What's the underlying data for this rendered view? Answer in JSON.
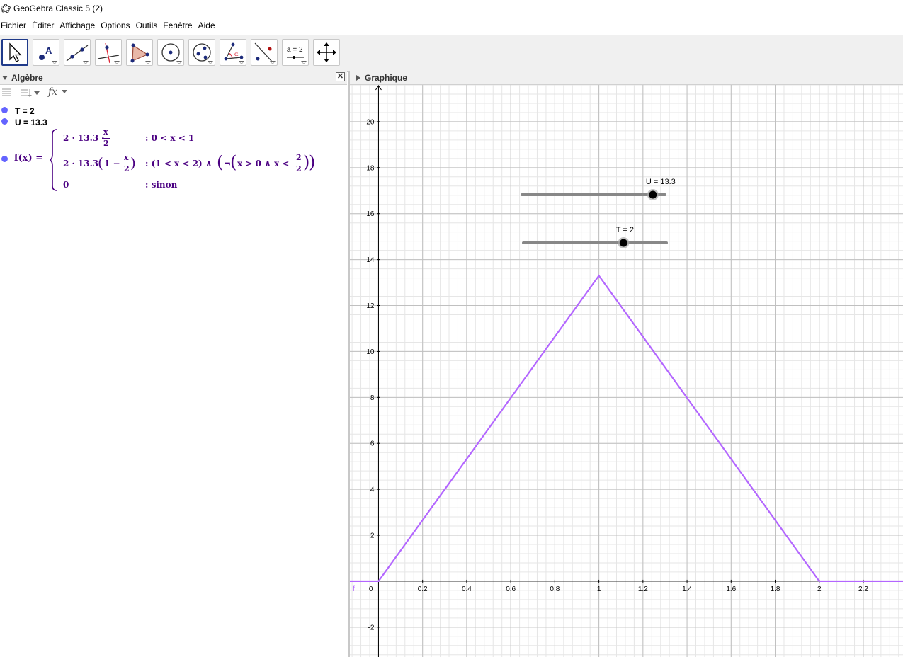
{
  "window": {
    "title": "GeoGebra Classic 5 (2)"
  },
  "menu": [
    "Fichier",
    "Éditer",
    "Affichage",
    "Options",
    "Outils",
    "Fenêtre",
    "Aide"
  ],
  "toolbar": {
    "tools": [
      {
        "name": "move-tool",
        "icon": "arrow-cursor-icon",
        "active": true
      },
      {
        "name": "point-tool",
        "icon": "point-icon"
      },
      {
        "name": "line-tool",
        "icon": "line-icon"
      },
      {
        "name": "perpendicular-tool",
        "icon": "perpendicular-icon"
      },
      {
        "name": "polygon-tool",
        "icon": "polygon-icon"
      },
      {
        "name": "circle-tool",
        "icon": "circle-icon"
      },
      {
        "name": "conic-tool",
        "icon": "ellipse-icon"
      },
      {
        "name": "angle-tool",
        "icon": "angle-icon"
      },
      {
        "name": "reflect-tool",
        "icon": "reflect-icon"
      },
      {
        "name": "slider-tool",
        "icon": "slider-icon",
        "label": "a = 2"
      },
      {
        "name": "move-graphics-tool",
        "icon": "move-arrows-icon"
      }
    ]
  },
  "algebra": {
    "title": "Algèbre",
    "items": [
      {
        "text": "T = 2"
      },
      {
        "text": "U = 13.3"
      }
    ],
    "function": {
      "name": "f(x) =",
      "case1_expr_a": "2 · 13.3 ·",
      "case1_frac_num": "x",
      "case1_frac_den": "2",
      "case1_cond": ": 0 < x < 1",
      "case2_expr_a": "2 · 13.3",
      "case2_paren_open": "(",
      "case2_inner": "1 −",
      "case2_frac_num": "x",
      "case2_frac_den": "2",
      "case2_paren_close": ")",
      "case2_cond_a": ": (1 < x < 2) ∧",
      "case2_cond_b": "¬",
      "case2_cond_c": "x > 0 ∧ x <",
      "case2_cond_num": "2",
      "case2_cond_den": "2",
      "case3_expr": "0",
      "case3_cond": ": sinon"
    },
    "colors": {
      "dot": "#6464ff",
      "text": "#4b0082"
    }
  },
  "graphics": {
    "title": "Graphique",
    "function_label": "f",
    "sliders": [
      {
        "label": "U = 13.3",
        "value": 13.3,
        "min": -5,
        "max": 15
      },
      {
        "label": "T = 2",
        "value": 2,
        "min": -5,
        "max": 5
      }
    ],
    "colors": {
      "curve": "#b366ff",
      "grid_major": "#c0c0c0",
      "grid_minor": "#e6e6e6",
      "axis": "#000000"
    }
  },
  "chart_data": {
    "type": "line",
    "title": "",
    "xlabel": "",
    "ylabel": "",
    "grid": true,
    "xlim": [
      -0.13,
      2.38
    ],
    "ylim": [
      -3.3,
      21.6
    ],
    "x_ticks": [
      0.2,
      0.4,
      0.6,
      0.8,
      1,
      1.2,
      1.4,
      1.6,
      1.8,
      2,
      2.2
    ],
    "x_tick_labels": [
      "0.2",
      "0.4",
      "0.6",
      "0.8",
      "1",
      "1.2",
      "1.4",
      "1.6",
      "1.8",
      "2",
      "2.2"
    ],
    "y_ticks": [
      -2,
      2,
      4,
      6,
      8,
      10,
      12,
      14,
      16,
      18,
      20
    ],
    "y_tick_labels": [
      "-2",
      "2",
      "4",
      "6",
      "8",
      "10",
      "12",
      "14",
      "16",
      "18",
      "20"
    ],
    "origin_label": "0",
    "series": [
      {
        "name": "f",
        "x": [
          -0.13,
          0,
          1,
          2,
          2.38
        ],
        "y": [
          0,
          0,
          13.3,
          0,
          0
        ]
      }
    ]
  }
}
